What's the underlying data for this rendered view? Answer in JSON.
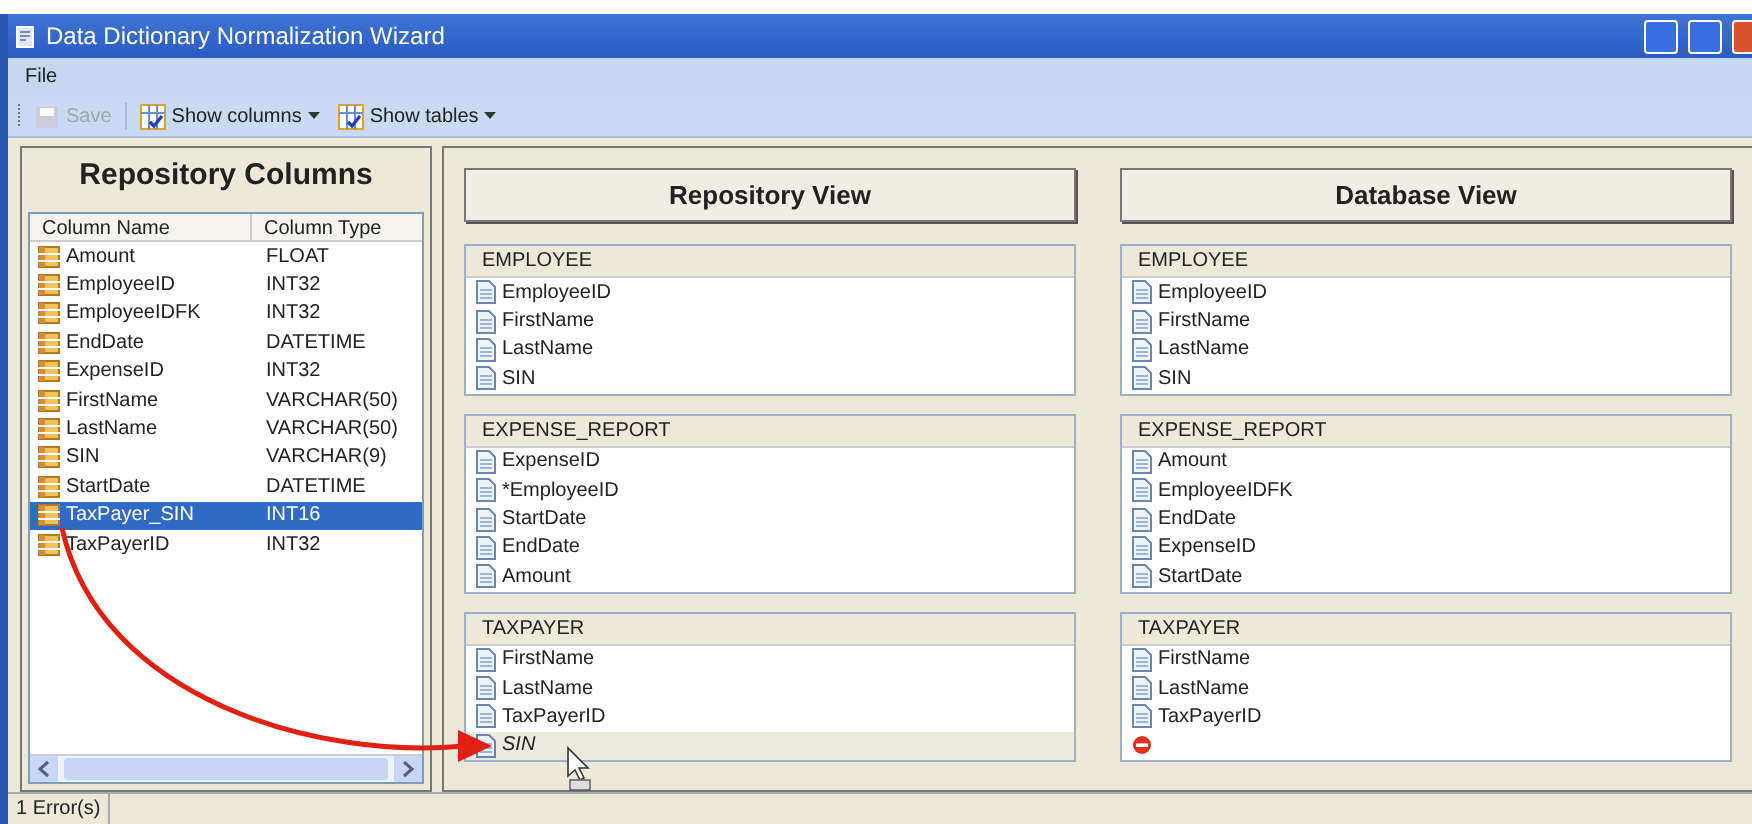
{
  "window": {
    "title": "Data Dictionary Normalization Wizard"
  },
  "menu": [
    "File"
  ],
  "toolbar": [
    {
      "label": "Save",
      "disabled": true,
      "dropdown": false
    },
    {
      "label": "Show columns",
      "disabled": false,
      "dropdown": true
    },
    {
      "label": "Show tables",
      "disabled": false,
      "dropdown": true
    }
  ],
  "repository_columns": {
    "title": "Repository Columns",
    "columns": [
      "Column Name",
      "Column Type"
    ],
    "rows": [
      {
        "name": "Amount",
        "type": "FLOAT",
        "selected": false
      },
      {
        "name": "EmployeeID",
        "type": "INT32",
        "selected": false
      },
      {
        "name": "EmployeeIDFK",
        "type": "INT32",
        "selected": false
      },
      {
        "name": "EndDate",
        "type": "DATETIME",
        "selected": false
      },
      {
        "name": "ExpenseID",
        "type": "INT32",
        "selected": false
      },
      {
        "name": "FirstName",
        "type": "VARCHAR(50)",
        "selected": false
      },
      {
        "name": "LastName",
        "type": "VARCHAR(50)",
        "selected": false
      },
      {
        "name": "SIN",
        "type": "VARCHAR(9)",
        "selected": false
      },
      {
        "name": "StartDate",
        "type": "DATETIME",
        "selected": false
      },
      {
        "name": "TaxPayer_SIN",
        "type": "INT16",
        "selected": true
      },
      {
        "name": "TaxPayerID",
        "type": "INT32",
        "selected": false
      }
    ]
  },
  "views": [
    {
      "title": "Repository View",
      "tables": [
        {
          "name": "EMPLOYEE",
          "items": [
            {
              "kind": "column",
              "label": "EmployeeID",
              "dropped": false
            },
            {
              "kind": "column",
              "label": "FirstName",
              "dropped": false
            },
            {
              "kind": "column",
              "label": "LastName",
              "dropped": false
            },
            {
              "kind": "column",
              "label": "SIN",
              "dropped": false
            }
          ]
        },
        {
          "name": "EXPENSE_REPORT",
          "items": [
            {
              "kind": "column",
              "label": "ExpenseID",
              "dropped": false
            },
            {
              "kind": "column",
              "label": "*EmployeeID",
              "dropped": false
            },
            {
              "kind": "column",
              "label": "StartDate",
              "dropped": false
            },
            {
              "kind": "column",
              "label": "EndDate",
              "dropped": false
            },
            {
              "kind": "column",
              "label": "Amount",
              "dropped": false
            }
          ]
        },
        {
          "name": "TAXPAYER",
          "items": [
            {
              "kind": "column",
              "label": "FirstName",
              "dropped": false
            },
            {
              "kind": "column",
              "label": "LastName",
              "dropped": false
            },
            {
              "kind": "column",
              "label": "TaxPayerID",
              "dropped": false
            },
            {
              "kind": "column",
              "label": "SIN",
              "dropped": true
            }
          ]
        }
      ]
    },
    {
      "title": "Database View",
      "tables": [
        {
          "name": "EMPLOYEE",
          "items": [
            {
              "kind": "column",
              "label": "EmployeeID",
              "dropped": false
            },
            {
              "kind": "column",
              "label": "FirstName",
              "dropped": false
            },
            {
              "kind": "column",
              "label": "LastName",
              "dropped": false
            },
            {
              "kind": "column",
              "label": "SIN",
              "dropped": false
            }
          ]
        },
        {
          "name": "EXPENSE_REPORT",
          "items": [
            {
              "kind": "column",
              "label": "Amount",
              "dropped": false
            },
            {
              "kind": "column",
              "label": "EmployeeIDFK",
              "dropped": false
            },
            {
              "kind": "column",
              "label": "EndDate",
              "dropped": false
            },
            {
              "kind": "column",
              "label": "ExpenseID",
              "dropped": false
            },
            {
              "kind": "column",
              "label": "StartDate",
              "dropped": false
            }
          ]
        },
        {
          "name": "TAXPAYER",
          "items": [
            {
              "kind": "column",
              "label": "FirstName",
              "dropped": false
            },
            {
              "kind": "column",
              "label": "LastName",
              "dropped": false
            },
            {
              "kind": "column",
              "label": "TaxPayerID",
              "dropped": false
            },
            {
              "kind": "error"
            }
          ]
        }
      ]
    }
  ],
  "status_bar": "1 Error(s)"
}
